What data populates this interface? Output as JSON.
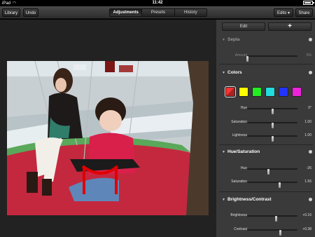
{
  "status": {
    "device": "iPad",
    "time": "11:42"
  },
  "toolbar": {
    "library": "Library",
    "undo": "Undo",
    "tabs": [
      "Adjustments",
      "Presets",
      "History"
    ],
    "edits": "Edits ▾",
    "share": "Share"
  },
  "panel": {
    "edit": "Edit",
    "plus": "+",
    "sepia": {
      "title": "Sepia",
      "amount_label": "Amount",
      "amount_value": "0%",
      "amount_level": 0.0
    },
    "colors": {
      "title": "Colors",
      "swatches": [
        "#ff3333",
        "#ffff00",
        "#22ee22",
        "#22dddd",
        "#2233ff",
        "#ee22dd"
      ],
      "hue_label": "Hue",
      "hue_value": "0°",
      "hue_level": 0.5,
      "sat_label": "Saturation",
      "sat_value": "1.00",
      "sat_level": 0.5,
      "light_label": "Lightness",
      "light_value": "1.00",
      "light_level": 0.5
    },
    "huesat": {
      "title": "Hue/Saturation",
      "hue_label": "Hue",
      "hue_value": "-26",
      "hue_level": 0.43,
      "sat_label": "Saturation",
      "sat_value": "1.56",
      "sat_level": 0.65
    },
    "brightcon": {
      "title": "Brightness/Contrast",
      "bright_label": "Brightness",
      "bright_value": "+0.16",
      "bright_level": 0.57,
      "con_label": "Contrast",
      "con_value": "+0.38",
      "con_level": 0.66
    }
  }
}
